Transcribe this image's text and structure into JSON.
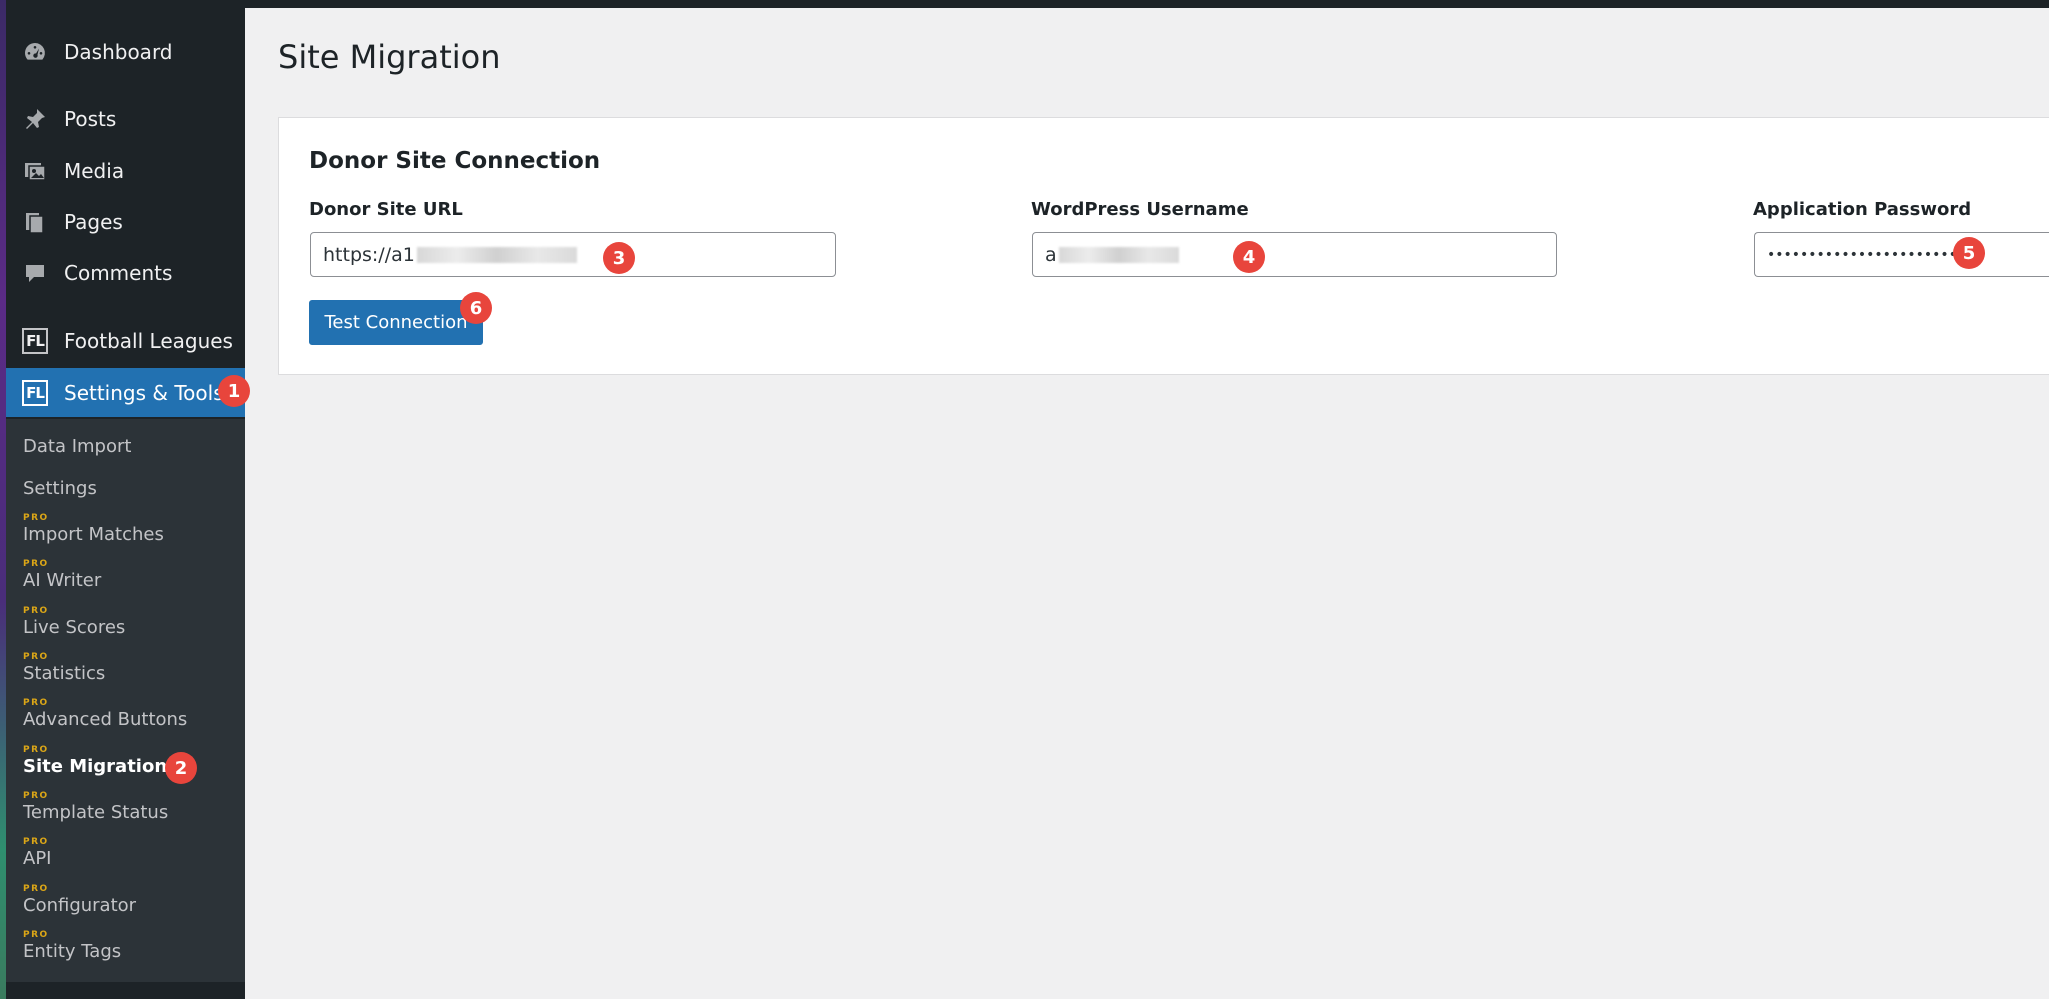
{
  "sidebar": {
    "items": [
      {
        "label": "Dashboard",
        "icon": "dashboard-icon"
      },
      {
        "label": "Posts",
        "icon": "pin-icon"
      },
      {
        "label": "Media",
        "icon": "media-icon"
      },
      {
        "label": "Pages",
        "icon": "pages-icon"
      },
      {
        "label": "Comments",
        "icon": "comment-icon"
      },
      {
        "label": "Football Leagues",
        "icon": "fl-logo-icon"
      },
      {
        "label": "Settings & Tools",
        "icon": "fl-logo-icon"
      }
    ],
    "logo_text": "FL",
    "submenu": [
      {
        "label": "Data Import",
        "pro": ""
      },
      {
        "label": "Settings",
        "pro": ""
      },
      {
        "label": "Import Matches",
        "pro": "PRO"
      },
      {
        "label": "AI Writer",
        "pro": "PRO"
      },
      {
        "label": "Live Scores",
        "pro": "PRO"
      },
      {
        "label": "Statistics",
        "pro": "PRO"
      },
      {
        "label": "Advanced Buttons",
        "pro": "PRO"
      },
      {
        "label": "Site Migration",
        "pro": "PRO"
      },
      {
        "label": "Template Status",
        "pro": "PRO"
      },
      {
        "label": "API",
        "pro": "PRO"
      },
      {
        "label": "Configurator",
        "pro": "PRO"
      },
      {
        "label": "Entity Tags",
        "pro": "PRO"
      }
    ]
  },
  "main": {
    "title": "Site Migration",
    "card": {
      "title": "Donor Site Connection",
      "fields": {
        "url": {
          "label": "Donor Site URL",
          "value": "https://a1"
        },
        "username": {
          "label": "WordPress Username",
          "value": "a"
        },
        "password": {
          "label": "Application Password",
          "value": "•••••••••••••••••••••••••"
        }
      },
      "test_button": "Test Connection"
    }
  },
  "annotations": [
    "1",
    "2",
    "3",
    "4",
    "5",
    "6"
  ],
  "colors": {
    "sidebar": "#1d2327",
    "submenu": "#2c3338",
    "accent": "#2271b1",
    "badge": "#e8453c",
    "pro": "#dba617"
  }
}
